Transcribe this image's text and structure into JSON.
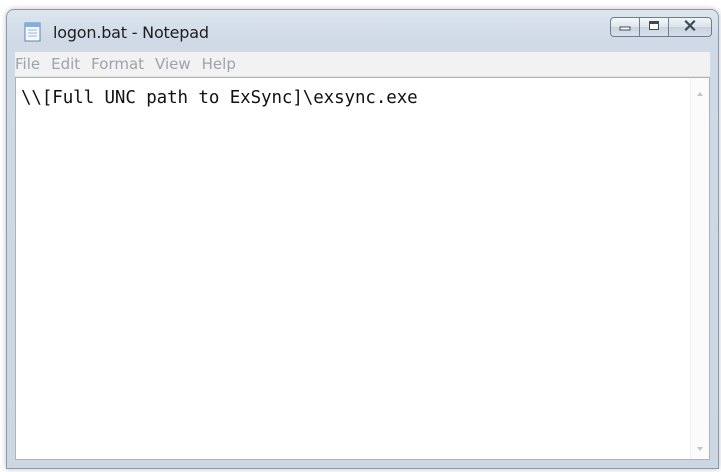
{
  "window": {
    "title": "logon.bat - Notepad",
    "controls": {
      "minimize": "minimize-icon",
      "maximize": "maximize-icon",
      "close": "close-icon"
    }
  },
  "menu": {
    "items": [
      "File",
      "Edit",
      "Format",
      "View",
      "Help"
    ]
  },
  "editor": {
    "text": "\\\\[Full UNC path to ExSync]\\exsync.exe"
  },
  "colors": {
    "title_bar": "#cfdae6",
    "menu_text_disabled": "#9da3aa",
    "editor_bg": "#ffffff"
  }
}
